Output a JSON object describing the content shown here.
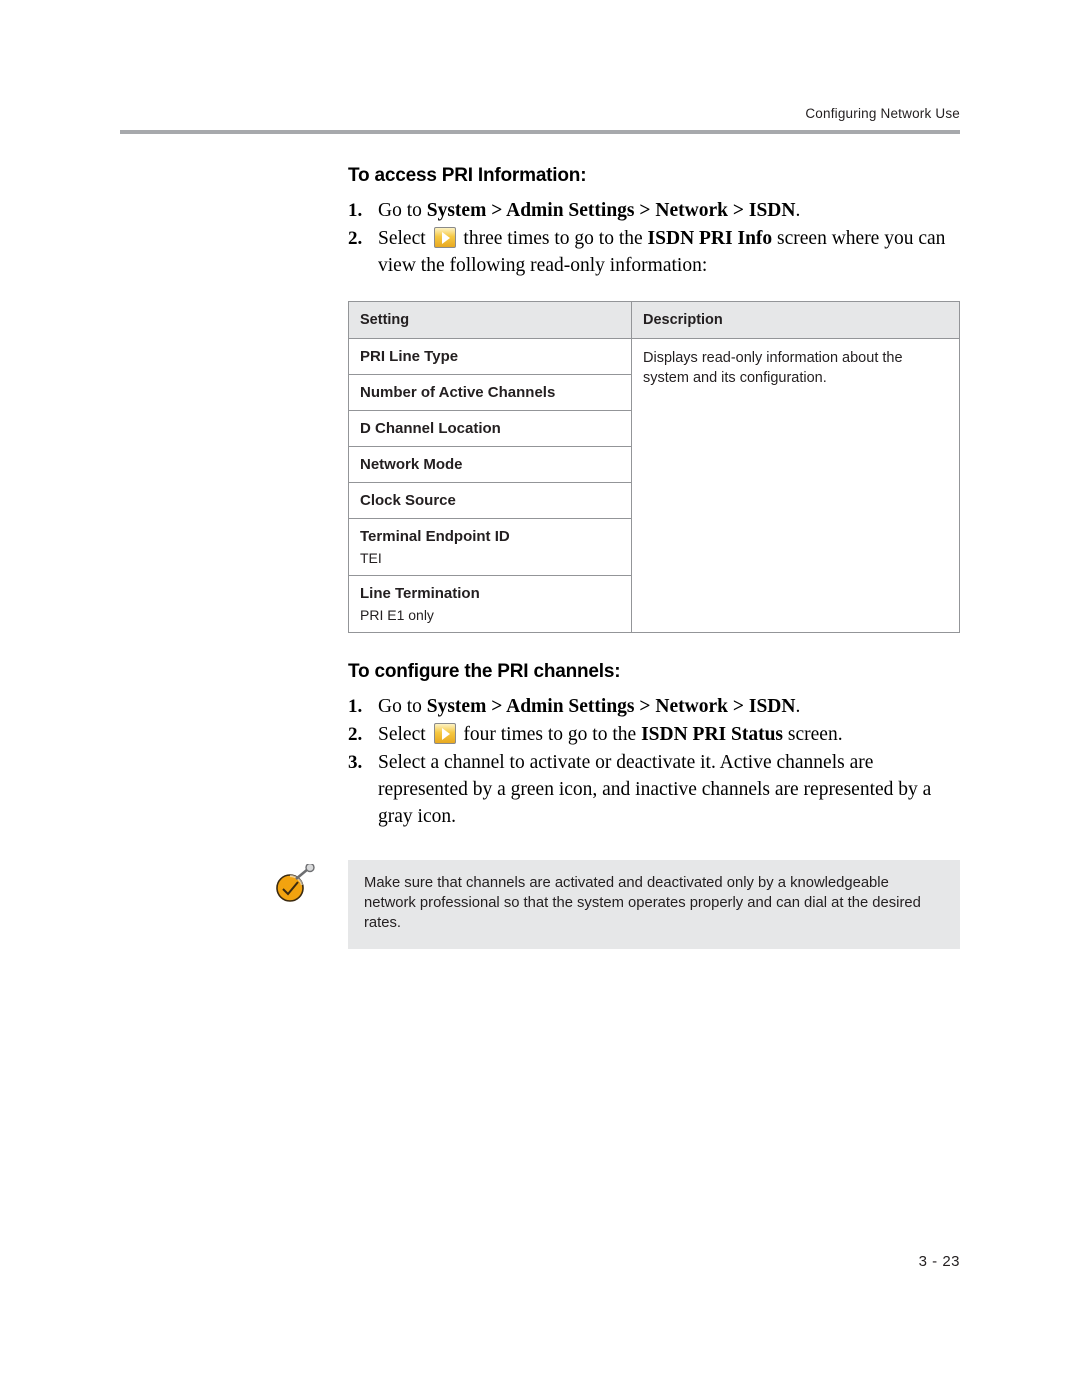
{
  "header": {
    "running_head": "Configuring Network Use"
  },
  "sections": [
    {
      "heading": "To access PRI Information:",
      "steps": [
        {
          "num": "1.",
          "pre": "Go to ",
          "bold1": "System",
          "mid1": " > ",
          "bold2": "Admin Settings",
          "mid2": " > ",
          "bold3": "Network",
          "mid3": " > ",
          "bold4": "ISDN",
          "post": "."
        },
        {
          "num": "2.",
          "pre": "Select ",
          "icon": "arrow-right-button-icon",
          "mid": " three times to go to the ",
          "bold": "ISDN PRI Info",
          "post": " screen where you can view the following read-only information:"
        }
      ]
    }
  ],
  "table": {
    "columns": [
      "Setting",
      "Description"
    ],
    "rows": [
      {
        "setting": "PRI Line Type",
        "sub": "",
        "description": "Displays read-only information about the system and its configuration."
      },
      {
        "setting": "Number of Active Channels",
        "sub": "",
        "description": ""
      },
      {
        "setting": "D Channel Location",
        "sub": "",
        "description": ""
      },
      {
        "setting": "Network Mode",
        "sub": "",
        "description": ""
      },
      {
        "setting": "Clock Source",
        "sub": "",
        "description": ""
      },
      {
        "setting": "Terminal Endpoint ID",
        "sub": "TEI",
        "description": ""
      },
      {
        "setting": "Line Termination",
        "sub": "PRI E1 only",
        "description": ""
      }
    ]
  },
  "section2": {
    "heading": "To configure the PRI channels:",
    "step1": {
      "num": "1.",
      "pre": "Go to ",
      "bold1": "System",
      "mid1": " > ",
      "bold2": "Admin Settings",
      "mid2": " > ",
      "bold3": "Network",
      "mid3": " > ",
      "bold4": "ISDN",
      "post": "."
    },
    "step2": {
      "num": "2.",
      "pre": "Select ",
      "icon": "arrow-right-button-icon",
      "mid": " four times to go to the ",
      "bold": "ISDN PRI Status",
      "post": " screen."
    },
    "step3": {
      "num": "3.",
      "text": "Select a channel to activate or deactivate it. Active channels are represented by a green icon, and inactive channels are represented by a gray icon."
    }
  },
  "note": {
    "icon": "note-pushpin-icon",
    "text": "Make sure that channels are activated and deactivated only by a knowledgeable network professional so that the system operates properly and can dial at the desired rates."
  },
  "footer": {
    "page_number": "3 - 23"
  },
  "colors": {
    "rule": "#a7a9ac",
    "table_header_bg": "#e6e7e8",
    "table_border": "#939598",
    "note_bg": "#e6e7e8",
    "icon_yellow": "#f5c842"
  }
}
